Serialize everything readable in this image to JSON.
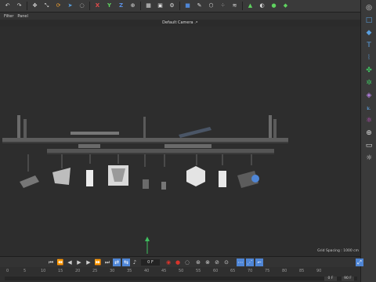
{
  "viewport_menu": {
    "items": [
      "Filter",
      "Panel"
    ]
  },
  "camera_label": "Default Camera ․‣",
  "grid_spacing": "Grid Spacing : 1000 cm",
  "timeline": {
    "current_frame": "0 F",
    "ruler_ticks": [
      "0",
      "5",
      "10",
      "15",
      "20",
      "25",
      "30",
      "35",
      "40",
      "45",
      "50",
      "55",
      "60",
      "65",
      "70",
      "75",
      "80",
      "85",
      "90"
    ],
    "start_field": "0 F",
    "end_field": "90 F"
  },
  "colors": {
    "accent_blue": "#4f86d6",
    "record_red": "#d9342b",
    "axis_green": "#3fbf5f"
  }
}
